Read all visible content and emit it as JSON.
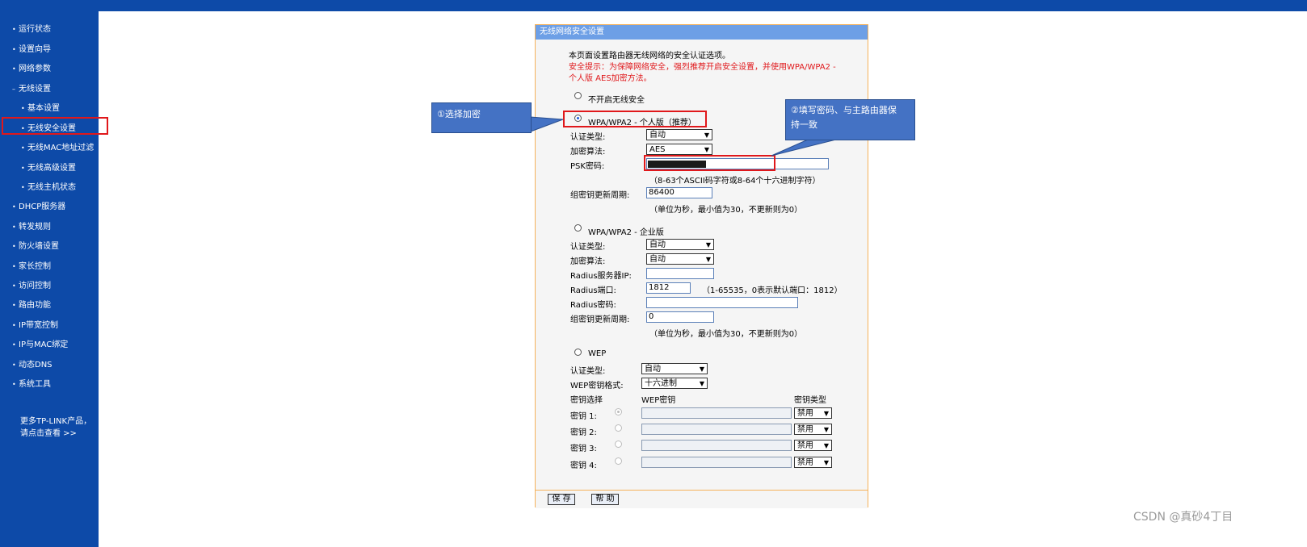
{
  "sidebar": {
    "items": [
      {
        "label": "运行状态",
        "level": "top"
      },
      {
        "label": "设置向导",
        "level": "top"
      },
      {
        "label": "网络参数",
        "level": "top"
      },
      {
        "label": "无线设置",
        "level": "top"
      },
      {
        "label": "基本设置",
        "level": "sub"
      },
      {
        "label": "无线安全设置",
        "level": "sub",
        "active": true
      },
      {
        "label": "无线MAC地址过滤",
        "level": "sub"
      },
      {
        "label": "无线高级设置",
        "level": "sub"
      },
      {
        "label": "无线主机状态",
        "level": "sub"
      },
      {
        "label": "DHCP服务器",
        "level": "top"
      },
      {
        "label": "转发规则",
        "level": "top"
      },
      {
        "label": "防火墙设置",
        "level": "top"
      },
      {
        "label": "家长控制",
        "level": "top"
      },
      {
        "label": "访问控制",
        "level": "top"
      },
      {
        "label": "路由功能",
        "level": "top"
      },
      {
        "label": "IP带宽控制",
        "level": "top"
      },
      {
        "label": "IP与MAC绑定",
        "level": "top"
      },
      {
        "label": "动态DNS",
        "level": "top"
      },
      {
        "label": "系统工具",
        "level": "top"
      }
    ],
    "more_line1": "更多TP-LINK产品，",
    "more_line2": "请点击查看 >>"
  },
  "panel": {
    "title": "无线网络安全设置",
    "intro": "本页面设置路由器无线网络的安全认证选项。",
    "warning_line1": "安全提示：为保障网络安全，强烈推荐开启安全设置，并使用WPA/WPA2 -",
    "warning_line2": "个人版 AES加密方法。",
    "option_none": "不开启无线安全",
    "personal": {
      "label": "WPA/WPA2 - 个人版（推荐）",
      "auth_label": "认证类型:",
      "auth_value": "自动",
      "enc_label": "加密算法:",
      "enc_value": "AES",
      "psk_label": "PSK密码:",
      "psk_hint": "（8-63个ASCII码字符或8-64个十六进制字符）",
      "renew_label": "组密钥更新周期:",
      "renew_value": "86400",
      "renew_hint": "（单位为秒，最小值为30，不更新则为0）"
    },
    "enterprise": {
      "label": "WPA/WPA2 - 企业版",
      "auth_label": "认证类型:",
      "auth_value": "自动",
      "enc_label": "加密算法:",
      "enc_value": "自动",
      "radius_ip_label": "Radius服务器IP:",
      "radius_port_label": "Radius端口:",
      "radius_port_value": "1812",
      "radius_port_hint": "（1-65535，0表示默认端口：1812）",
      "radius_pwd_label": "Radius密码:",
      "renew_label": "组密钥更新周期:",
      "renew_value": "0",
      "renew_hint": "（单位为秒，最小值为30，不更新则为0）"
    },
    "wep": {
      "label": "WEP",
      "auth_label": "认证类型:",
      "auth_value": "自动",
      "format_label": "WEP密钥格式:",
      "format_value": "十六进制",
      "col_select": "密钥选择",
      "col_key": "WEP密钥",
      "col_type": "密钥类型",
      "keys": [
        {
          "label": "密钥 1:",
          "type": "禁用"
        },
        {
          "label": "密钥 2:",
          "type": "禁用"
        },
        {
          "label": "密钥 3:",
          "type": "禁用"
        },
        {
          "label": "密钥 4:",
          "type": "禁用"
        }
      ]
    },
    "save_label": "保 存",
    "help_label": "帮 助"
  },
  "callouts": {
    "select_encryption": "①选择加密",
    "password_line1": "②填写密码、与主路由器保",
    "password_line2": "持一致"
  },
  "watermark": "CSDN @真砂4丁目",
  "colors": {
    "sidebar": "#0d4aa8",
    "panel_title": "#6d9fe6",
    "highlight": "#e0181b",
    "callout": "#4472c4",
    "panel_border": "#f5b25b"
  }
}
